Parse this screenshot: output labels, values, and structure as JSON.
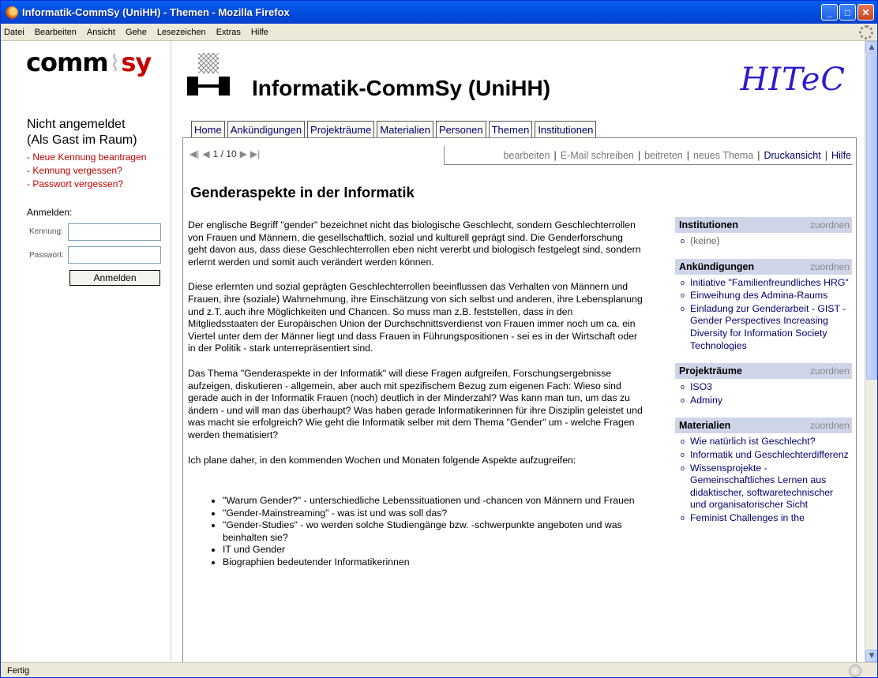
{
  "window": {
    "title": "Informatik-CommSy (UniHH) - Themen - Mozilla Firefox"
  },
  "menubar": [
    "Datei",
    "Bearbeiten",
    "Ansicht",
    "Gehe",
    "Lesezeichen",
    "Extras",
    "Hilfe"
  ],
  "left": {
    "logo_left": "comm",
    "logo_right": "sy",
    "login_state_1": "Nicht angemeldet",
    "login_state_2": "(Als Gast im Raum)",
    "links": [
      "- Neue Kennung beantragen",
      "- Kennung vergessen?",
      "- Passwort vergessen?"
    ],
    "login_heading": "Anmelden:",
    "user_label": "Kennung:",
    "pass_label": "Passwort:",
    "login_button": "Anmelden"
  },
  "header": {
    "site_title": "Informatik-CommSy (UniHH)",
    "partner_logo": "HITeC"
  },
  "tabs": [
    "Home",
    "Ankündigungen",
    "Projekträume",
    "Materialien",
    "Personen",
    "Themen",
    "Institutionen"
  ],
  "active_tab": "Themen",
  "toolbar": {
    "pager_text": "1 / 10",
    "actions": [
      "bearbeiten",
      "E-Mail schreiben",
      "beitreten",
      "neues Thema",
      "Druckansicht",
      "Hilfe"
    ]
  },
  "page": {
    "heading": "Genderaspekte in der Informatik",
    "paragraphs": [
      "Der englische Begriff \"gender\" bezeichnet nicht das biologische Geschlecht, sondern Geschlechterrollen von Frauen und Männern, die gesellschaftlich, sozial und kulturell geprägt sind. Die Genderforschung geht davon aus, dass diese Geschlechterrollen eben nicht vererbt und biologisch festgelegt sind, sondern erlernt werden und somit auch verändert werden können.",
      "Diese erlernten und sozial geprägten Geschlechterrollen beeinflussen das Verhalten von Männern und Frauen, ihre (soziale) Wahrnehmung, ihre Einschätzung von sich selbst und anderen, ihre Lebensplanung und z.T. auch ihre Möglichkeiten und Chancen. So muss man z.B. feststellen, dass in den Mitgliedsstaaten der Europäischen Union der Durchschnittsverdienst von Frauen immer noch um ca. ein Viertel unter dem der Männer liegt und dass Frauen in Führungspositionen - sei es in der Wirtschaft oder in der Politik - stark unterrepräsentiert sind.",
      "Das Thema \"Genderaspekte in der Informatik\" will diese Fragen aufgreifen, Forschungsergebnisse aufzeigen, diskutieren - allgemein, aber auch mit spezifischem Bezug zum eigenen Fach: Wieso sind gerade auch in der Informatik Frauen (noch) deutlich in der Minderzahl? Was kann man tun, um das zu ändern - und will man das überhaupt? Was haben gerade Informatikerinnen für ihre Disziplin geleistet und was macht sie erfolgreich? Wie geht die Informatik selber mit dem Thema \"Gender\" um - welche Fragen werden thematisiert?",
      "Ich plane daher, in den kommenden Wochen und Monaten folgende Aspekte aufzugreifen:"
    ],
    "bullets": [
      "\"Warum Gender?\" - unterschiedliche Lebenssituationen und -chancen von Männern und Frauen",
      "\"Gender-Mainstreaming\" - was ist und was soll das?",
      "\"Gender-Studies\" - wo werden solche Studiengänge bzw. -schwerpunkte angeboten und was beinhalten sie?",
      "IT und Gender",
      "Biographien bedeutender Informatikerinnen"
    ]
  },
  "sidebar": {
    "assign_label": "zuordnen",
    "boxes": [
      {
        "title": "Institutionen",
        "items": [
          "(keine)"
        ]
      },
      {
        "title": "Ankündigungen",
        "items": [
          "Initiative \"Familienfreundliches HRG\"",
          "Einweihung des Admina-Raums",
          "Einladung zur Genderarbeit - GIST - Gender Perspectives Increasing Diversity for Information Society Technologies"
        ]
      },
      {
        "title": "Projekträume",
        "items": [
          "ISO3",
          "Adminy"
        ]
      },
      {
        "title": "Materialien",
        "items": [
          "Wie natürlich ist Geschlecht?",
          "Informatik und Geschlechterdifferenz",
          "Wissensprojekte - Gemeinschaftliches Lernen aus didaktischer, softwaretechnischer und organisatorischer Sicht",
          "Feminist Challenges in the"
        ]
      }
    ]
  },
  "status": {
    "text": "Fertig"
  }
}
